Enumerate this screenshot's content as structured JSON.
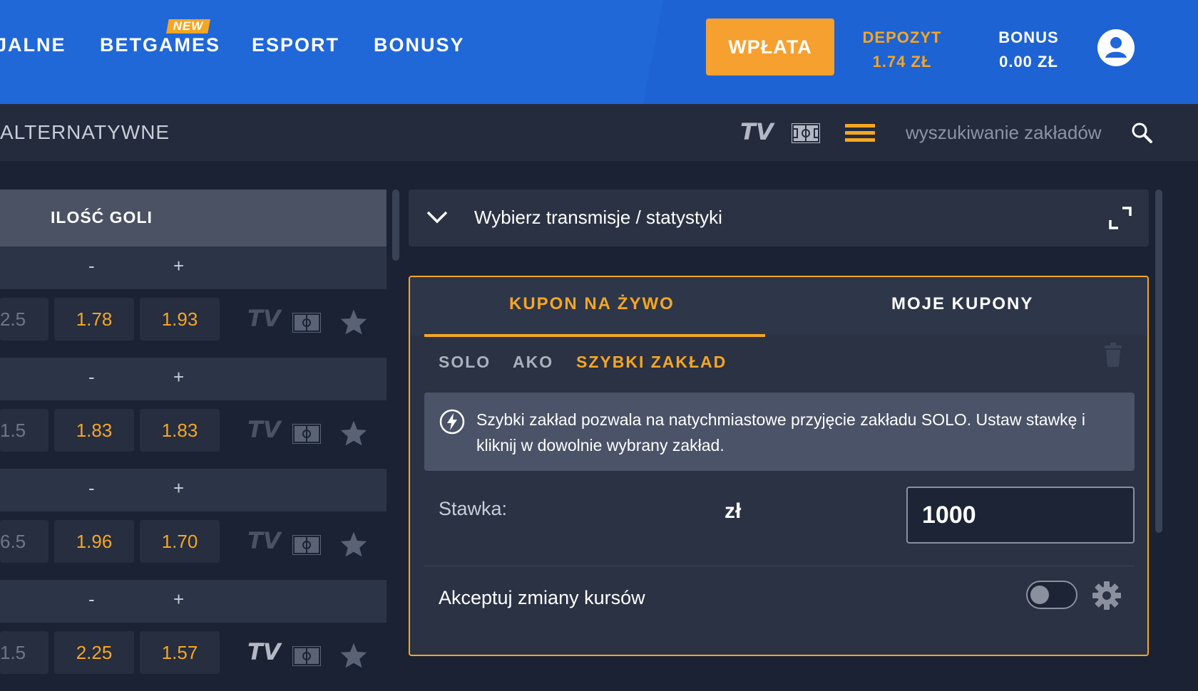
{
  "header": {
    "nav": [
      {
        "label": "JALNE"
      },
      {
        "label": "BETGAMES",
        "badge": "NEW"
      },
      {
        "label": "ESPORT"
      },
      {
        "label": "BONUSY"
      }
    ],
    "deposit_button": "WPŁATA",
    "depozyt": {
      "label": "DEPOZYT",
      "value": "1.74 ZŁ"
    },
    "bonus": {
      "label": "BONUS",
      "value": "0.00 ZŁ"
    }
  },
  "subbar": {
    "title": "ALTERNATYWNE",
    "tv_label": "TV",
    "search_placeholder": "wyszukiwanie zakładów"
  },
  "market": {
    "header": "ILOŚĆ GOLI",
    "minus": "-",
    "plus": "+",
    "rows": [
      {
        "line": "2.5",
        "odd1": "1.78",
        "odd2": "1.93",
        "tv": "TV",
        "tv_active": false
      },
      {
        "line": "1.5",
        "odd1": "1.83",
        "odd2": "1.83",
        "tv": "TV",
        "tv_active": false
      },
      {
        "line": "6.5",
        "odd1": "1.96",
        "odd2": "1.70",
        "tv": "TV",
        "tv_active": false
      },
      {
        "line": "1.5",
        "odd1": "2.25",
        "odd2": "1.57",
        "tv": "TV",
        "tv_active": true
      }
    ]
  },
  "stream": {
    "label": "Wybierz transmisje / statystyki"
  },
  "coupon": {
    "tabs": [
      "KUPON NA ŻYWO",
      "MOJE KUPONY"
    ],
    "subtabs": [
      "SOLO",
      "AKO",
      "SZYBKI ZAKŁAD"
    ],
    "info": "Szybki zakład pozwala na natychmiastowe przyjęcie zakładu SOLO. Ustaw stawkę i kliknij w dowolnie wybrany zakład.",
    "stake_label": "Stawka:",
    "currency": "zł",
    "stake_value": "1000",
    "accept_label": "Akceptuj zmiany kursów"
  },
  "colors": {
    "accent": "#f6a623",
    "header_blue": "#2067d8",
    "panel": "#2a3244",
    "background": "#1b2233"
  }
}
